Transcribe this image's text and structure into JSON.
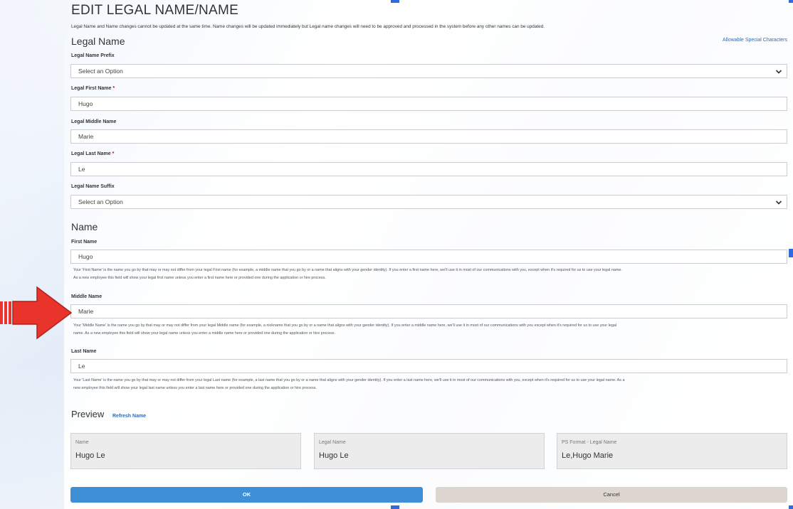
{
  "page": {
    "title": "EDIT LEGAL NAME/NAME",
    "intro": "Legal Name and Name changes cannot be updated at the same time. Name changes will be updated immediately but Legal name changes will need to be approved and processed in the system before any other names can be updated."
  },
  "legal_name": {
    "section_title": "Legal Name",
    "special_chars_link": "Allowable Special Characters",
    "prefix": {
      "label": "Legal Name Prefix",
      "value": "Select an Option"
    },
    "first": {
      "label": "Legal First Name",
      "required_mark": "*",
      "value": "Hugo"
    },
    "middle": {
      "label": "Legal Middle Name",
      "value": "Marie"
    },
    "last": {
      "label": "Legal Last Name",
      "required_mark": "*",
      "value": "Le"
    },
    "suffix": {
      "label": "Legal Name Suffix",
      "value": "Select an Option"
    }
  },
  "name": {
    "section_title": "Name",
    "first": {
      "label": "First Name",
      "value": "Hugo",
      "help_line1": "Your 'First Name' is the name you go by that may or may not differ from your legal First name (for example, a middle name that you go by or a name that aligns with your gender identity). If you enter a first name here, we'll use it in most of our communications with you, except when it's required for us to use your legal name.",
      "help_line2": "As a new employee this field will show your legal first name unless you enter a first name here or provided one during the application or hire process."
    },
    "middle": {
      "label": "Middle Name",
      "value": "Marie",
      "help_line1": "Your 'Middle Name' is the name you go by that may or may not differ from your legal Middle name (for example, a nickname that you go by or a name that aligns with your gender identity). If you enter a middle name here, we'll use it in most of our communications with you except when it's required for us to use your legal",
      "help_line2": "name. As a new employee this field will show your legal name unless you enter a middle name here or provided one during the application or hire process."
    },
    "last": {
      "label": "Last Name",
      "value": "Le",
      "help_line1": "Your 'Last Name' is the name you go by that may or may not differ from your legal Last name (for example, a last name that you go by or a name that aligns with your gender identity). If you enter a last name here, we'll use it in most of our communications with you, except when it's required for us to use your legal name. As a",
      "help_line2": "new employee this field will show your legal last name unless you enter a last name here or provided one during the application or hire process."
    }
  },
  "preview": {
    "title": "Preview",
    "refresh_link": "Refresh Name",
    "boxes": [
      {
        "label": "Name",
        "value": "Hugo Le"
      },
      {
        "label": "Legal Name",
        "value": "Hugo Le"
      },
      {
        "label": "PS Format - Legal Name",
        "value": "Le,Hugo Marie"
      }
    ]
  },
  "actions": {
    "ok_label": "OK",
    "cancel_label": "Cancel"
  },
  "colors": {
    "accent": "#3f8fd6",
    "link": "#2e6bb3",
    "required": "#d0021b",
    "arrow": "#e8342a",
    "cancel_bg": "#ddd6cf"
  },
  "icons": {
    "select_chevron": "chevron-down-icon",
    "pointer": "arrow-right-icon"
  }
}
